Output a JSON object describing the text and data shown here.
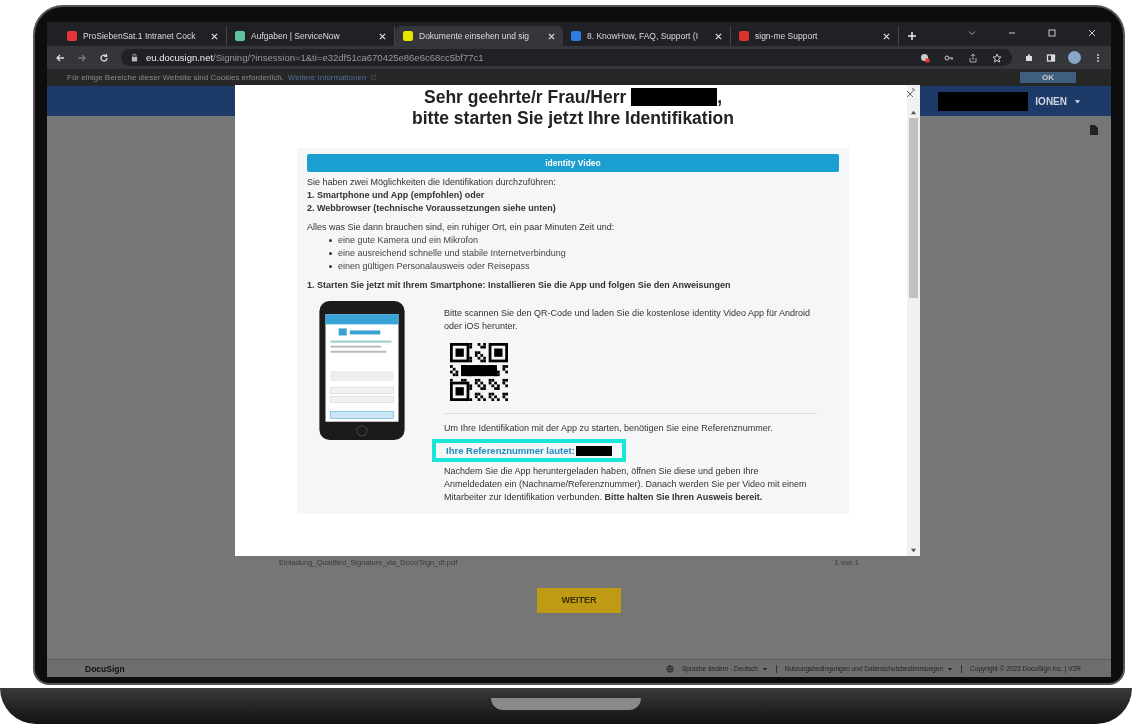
{
  "browser": {
    "tabs": [
      {
        "title": "ProSiebenSat.1 Intranet Cock",
        "selected": false,
        "color": "#e8333a"
      },
      {
        "title": "Aufgaben | ServiceNow",
        "selected": false,
        "color": "#62c3a1"
      },
      {
        "title": "Dokumente einsehen und sig",
        "selected": true,
        "color": "#e6e600"
      },
      {
        "title": "8. KnowHow, FAQ, Support (I",
        "selected": false,
        "color": "#2f7de1"
      },
      {
        "title": "sign-me Support",
        "selected": false,
        "color": "#d9342b"
      }
    ],
    "url_domain": "eu.docusign.net",
    "url_path": "/Signing/?insession=1&ti=e32df51ca670425e86e6c68cc5bf77c1"
  },
  "cookie_bar": {
    "text": "Für einige Bereiche dieser Website sind Cookies erforderlich.",
    "link": "Weitere Informationen",
    "button": "OK"
  },
  "header": {
    "menu": "IONEN"
  },
  "modal": {
    "title_line1": "Sehr geehrte/r Frau/Herr",
    "title_suffix": ",",
    "title_line2": "bitte starten Sie jetzt Ihre Identifikation",
    "panel_heading": "identity Video",
    "intro": "Sie haben zwei Möglichkeiten die Identifikation durchzuführen:",
    "options": [
      "1. Smartphone und App (empfohlen) oder",
      "2. Webbrowser (technische Voraussetzungen siehe unten)"
    ],
    "needs_intro": "Alles was Sie dann brauchen sind, ein ruhiger Ort, ein paar Minuten Zeit und:",
    "needs": [
      "eine gute Kamera und ein Mikrofon",
      "eine ausreichend schnelle und stabile Internetverbindung",
      "einen gültigen Personalausweis oder Reisepass"
    ],
    "step_heading": "1. Starten Sie jetzt mit Ihrem Smartphone: Installieren Sie die App und folgen Sie den Anweisungen",
    "scan_text": "Bitte scannen Sie den QR-Code und laden Sie die kostenlose identity Video App für Android oder iOS herunter.",
    "reference_intro": "Um Ihre Identifikation mit der App zu starten, benötigen Sie eine Referenznummer.",
    "reference_label": "Ihre Referenznummer lautet:",
    "reference_highlighted": true,
    "closing": "Nachdem Sie die App heruntergeladen haben, öffnen Sie diese und geben Ihre Anmeldedaten ein (Nachname/Referenznummer). Danach werden Sie per Video mit einem Mitarbeiter zur Identifikation verbunden. **Bitte halten Sie Ihren Ausweis bereit.**"
  },
  "document": {
    "filename": "Einladung_Qualified_Signature_via_Docu'Sign_dt.pdf",
    "pages": "1 von 1"
  },
  "continue_button": "WEITER",
  "footer": {
    "brand": "DocuSign",
    "language": "Sprache ändern - Deutsch",
    "terms": "Nutzungsbedingungen und Datenschutzbestimmungen",
    "copyright": "Copyright © 2023 DocuSign Inc. | V2R"
  }
}
